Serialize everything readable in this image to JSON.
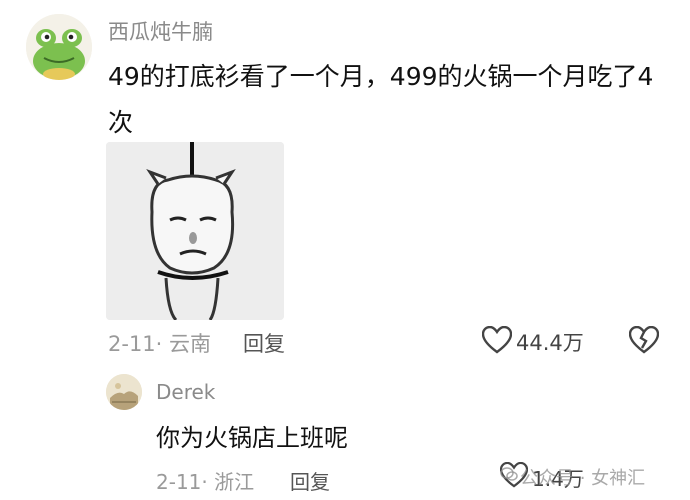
{
  "main_comment": {
    "username": "西瓜炖牛腩",
    "text": "49的打底衫看了一个月，499的火锅一个月吃了4次",
    "date_location": "2-11· 云南",
    "reply_label": "回复",
    "like_count": "44.4万"
  },
  "sub_comment": {
    "username": "Derek",
    "text": "你为火锅店上班呢",
    "date_location": "2-11· 浙江",
    "reply_label": "回复",
    "like_count": "1.4万"
  },
  "watermark": {
    "text": "公众号 · 女神汇"
  },
  "colors": {
    "text_primary": "#111111",
    "text_muted": "#9a9a9a",
    "username": "#8a8a8a"
  },
  "icons": [
    "frog-avatar-icon",
    "meme-image",
    "heart-icon",
    "broken-heart-icon",
    "derek-avatar-icon",
    "wechat-icon"
  ]
}
